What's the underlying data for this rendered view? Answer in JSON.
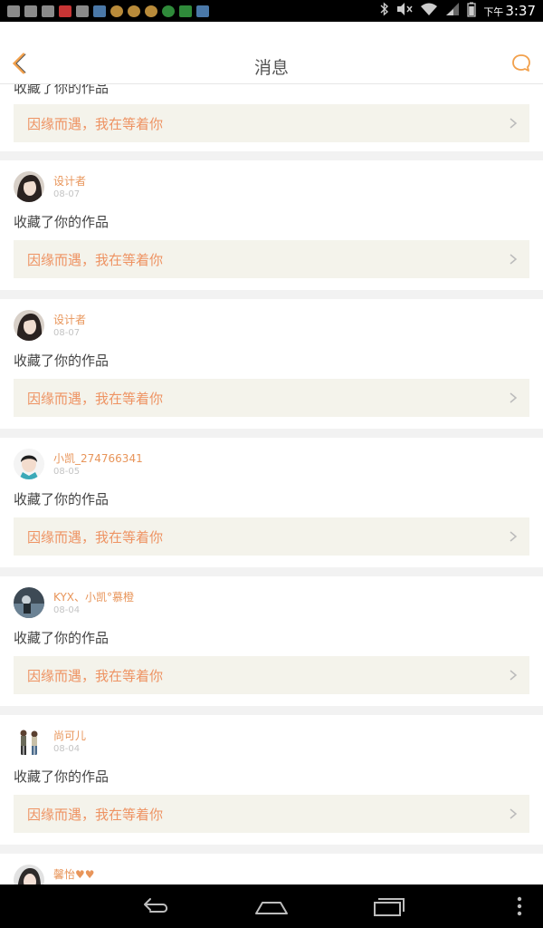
{
  "status_bar": {
    "time_prefix": "下午",
    "time": "3:37"
  },
  "header": {
    "title": "消息",
    "back_icon": "chevron-left-icon",
    "chat_icon": "chat-bubble-icon",
    "accent": "#f2a04b"
  },
  "notifications": [
    {
      "user": "",
      "date": "",
      "action": "收藏了你的作品",
      "work_title": "因缘而遇，我在等着你"
    },
    {
      "user": "设计者",
      "date": "08-07",
      "action": "收藏了你的作品",
      "work_title": "因缘而遇，我在等着你"
    },
    {
      "user": "设计者",
      "date": "08-07",
      "action": "收藏了你的作品",
      "work_title": "因缘而遇，我在等着你"
    },
    {
      "user": "小凯_274766341",
      "date": "08-05",
      "action": "收藏了你的作品",
      "work_title": "因缘而遇，我在等着你"
    },
    {
      "user": "KYX、小凯°慕橙",
      "date": "08-04",
      "action": "收藏了你的作品",
      "work_title": "因缘而遇，我在等着你"
    },
    {
      "user": "尚可儿",
      "date": "08-04",
      "action": "收藏了你的作品",
      "work_title": "因缘而遇，我在等着你"
    },
    {
      "user": "馨怡♥♥",
      "date": "",
      "action": "",
      "work_title": ""
    }
  ],
  "colors": {
    "username": "#e8955a",
    "work_title": "#ee9363",
    "work_bar_bg": "#f4f3eb"
  }
}
